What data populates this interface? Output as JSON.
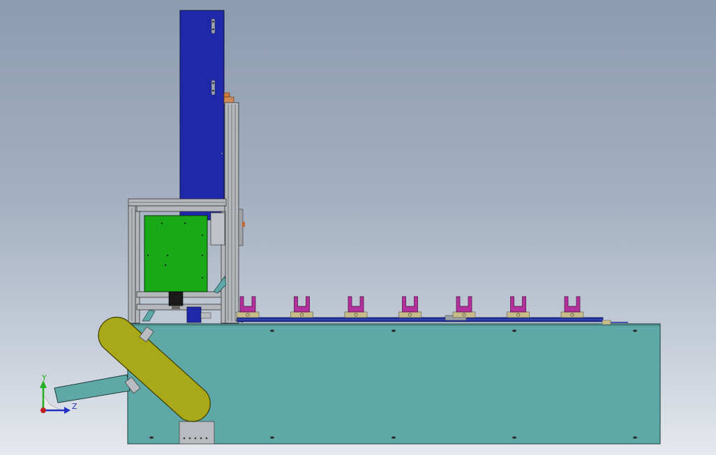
{
  "viewport": {
    "background_top": "#8d9bb1",
    "background_bottom": "#e6e9ee"
  },
  "colors": {
    "base_cabinet": "#5fa8a8",
    "blue_column": "#1e28a8",
    "green_panel": "#18a818",
    "yellow_belt": "#a8a818",
    "frame_profile": "#b4b8bc",
    "fixture_magenta": "#b4309c",
    "fixture_base": "#c8bc88",
    "conveyor_rail": "#2030a0"
  },
  "model": {
    "fixture_count": 7,
    "parts": [
      "base-cabinet",
      "vertical-axis-column",
      "aluminum-frame",
      "control-panel",
      "incline-conveyor-belt",
      "feed-chute",
      "horizontal-conveyor",
      "part-fixtures"
    ]
  },
  "triad": {
    "y_label": "Y",
    "z_label": "Z",
    "y_color": "#20b020",
    "z_color": "#2030c0",
    "origin_color": "#c02020"
  }
}
